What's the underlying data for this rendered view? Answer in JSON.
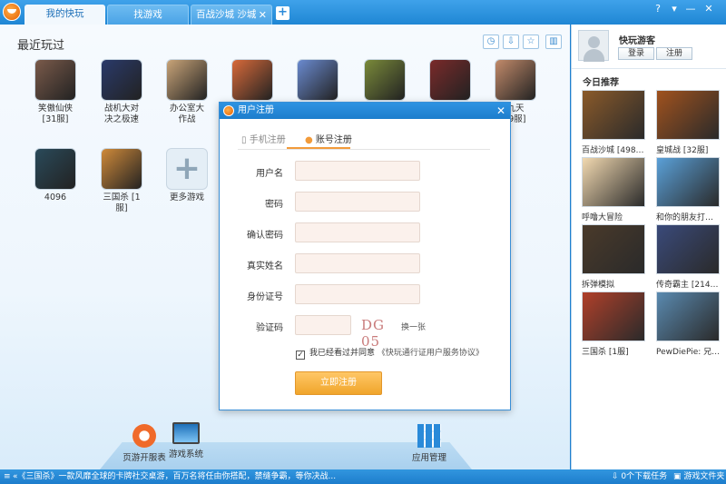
{
  "tabs": [
    {
      "label": "我的快玩",
      "active": true
    },
    {
      "label": "找游戏",
      "active": false
    },
    {
      "label": "百战沙城  沙城4…",
      "active": false
    }
  ],
  "window_controls": [
    "?",
    "▾",
    "—",
    "✕"
  ],
  "main": {
    "section_title": "最近玩过",
    "toolbar_icons": [
      "clock-icon",
      "download-icon",
      "star-icon",
      "trash-icon"
    ],
    "recent_games": [
      {
        "name": "笑傲仙侠\n[31服]",
        "color": "#7a5a4a"
      },
      {
        "name": "战机大对\n决之极速",
        "color": "#2a3a6a"
      },
      {
        "name": "办公室大\n作战",
        "color": "#c9a478"
      },
      {
        "name": "",
        "color": "#d86a3a"
      },
      {
        "name": "",
        "color": "#6a8ad0"
      },
      {
        "name": "",
        "color": "#7a8a3a"
      },
      {
        "name": "",
        "color": "#7a2a2a"
      },
      {
        "name": "九天\n[9服]",
        "color": "#c28a6a"
      },
      {
        "name": "4096",
        "color": "#2a4a5a"
      },
      {
        "name": "三国杀 [1\n服]",
        "color": "#d08a3a"
      },
      {
        "name": "更多游戏",
        "color": "#e4eef6"
      }
    ],
    "dock": [
      {
        "label": "页游开服表"
      },
      {
        "label": "游戏系统"
      },
      {
        "label": "应用管理"
      }
    ]
  },
  "sidebar": {
    "username": "快玩游客",
    "login_label": "登录",
    "register_label": "注册",
    "recommend_title": "今日推荐",
    "recommendations": [
      {
        "name": "百战沙城 [498…",
        "color": "#8a5a2a"
      },
      {
        "name": "皇城战 [32服]",
        "color": "#a0521e"
      },
      {
        "name": "呼噜大冒险",
        "color": "#f2d9b0"
      },
      {
        "name": "和你的朋友打…",
        "color": "#5aa0d8"
      },
      {
        "name": "拆弹模拟",
        "color": "#4a3a2a"
      },
      {
        "name": "传奇霸主 [214…",
        "color": "#3a4a7a"
      },
      {
        "name": "三国杀 [1服]",
        "color": "#b0402a"
      },
      {
        "name": "PewDiePie: 兄…",
        "color": "#5a8ab0"
      }
    ]
  },
  "dialog": {
    "title": "用户注册",
    "tab_phone": "手机注册",
    "tab_account": "账号注册",
    "fields": [
      {
        "label": "用户名",
        "value": ""
      },
      {
        "label": "密码",
        "value": ""
      },
      {
        "label": "确认密码",
        "value": ""
      },
      {
        "label": "真实姓名",
        "value": ""
      },
      {
        "label": "身份证号",
        "value": ""
      },
      {
        "label": "验证码",
        "value": ""
      }
    ],
    "captcha_text": "DG 05",
    "refresh_label": "换一张",
    "agree_text": "我已经看过并同意",
    "agree_link": "《快玩通行证用户服务协议》",
    "submit_label": "立即注册"
  },
  "statusbar": {
    "marquee": "《三国杀》一款风靡全球的卡牌社交桌游，百万名将任由你搭配，禁缝争霸，等你决战...",
    "downloads": "0个下载任务",
    "game_folder": "游戏文件夹"
  },
  "colors": {
    "titlebar": "#2b8ad9",
    "accent_orange": "#f0a52b",
    "input_bg": "#fbf1ec"
  }
}
